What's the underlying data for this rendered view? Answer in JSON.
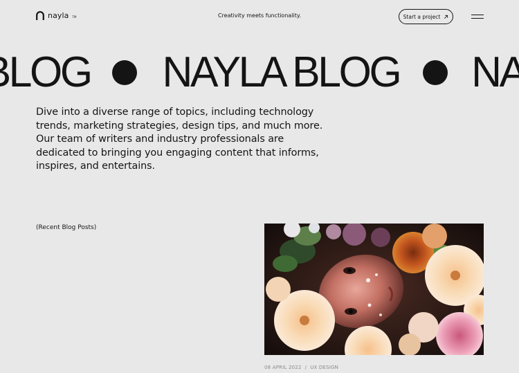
{
  "header": {
    "brand": "nayla",
    "brand_tm": "TM",
    "tagline": "Creativity meets functionality.",
    "cta_label": "Start a project",
    "cta_icon": "arrow-up-right-icon",
    "menu_icon": "hamburger-menu-icon"
  },
  "hero": {
    "marquee": [
      "BLOG",
      "NAYLA BLOG",
      "NAY"
    ],
    "intro": "Dive into a diverse range of topics, including technology trends, marketing strategies, design tips, and much more. Our team of writers and industry professionals are dedicated to bringing you engaging content that informs, inspires, and entertains."
  },
  "blog": {
    "section_label": "(Recent Blog Posts)",
    "posts": [
      {
        "date": "08 APRIL 2022",
        "separator": "/",
        "category": "UX DESIGN"
      }
    ]
  },
  "colors": {
    "background": "#e8e8e8",
    "text": "#141414",
    "muted": "#8a8a8a"
  }
}
